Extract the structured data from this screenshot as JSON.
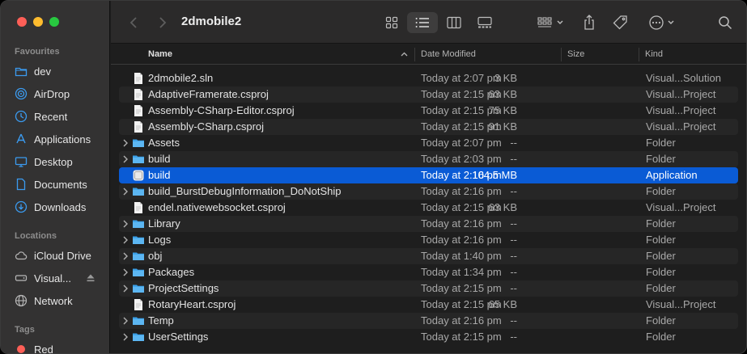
{
  "window": {
    "title": "2dmobile2"
  },
  "sidebar": {
    "sections": [
      {
        "label": "Favourites"
      },
      {
        "label": "Locations"
      },
      {
        "label": "Tags"
      }
    ],
    "favourites": [
      {
        "label": "dev",
        "icon": "folder-icon"
      },
      {
        "label": "AirDrop",
        "icon": "airdrop-icon"
      },
      {
        "label": "Recent",
        "icon": "clock-icon"
      },
      {
        "label": "Applications",
        "icon": "applications-icon"
      },
      {
        "label": "Desktop",
        "icon": "desktop-icon"
      },
      {
        "label": "Documents",
        "icon": "document-icon"
      },
      {
        "label": "Downloads",
        "icon": "download-icon"
      }
    ],
    "locations": [
      {
        "label": "iCloud Drive",
        "icon": "cloud-icon"
      },
      {
        "label": "Visual...",
        "icon": "disk-icon"
      },
      {
        "label": "Network",
        "icon": "network-icon"
      }
    ],
    "tags": [
      {
        "label": "Red",
        "color": "#fe5f57"
      }
    ]
  },
  "columns": {
    "name": "Name",
    "date": "Date Modified",
    "size": "Size",
    "kind": "Kind"
  },
  "files": [
    {
      "name": "2dmobile2.sln",
      "date": "Today at 2:07 pm",
      "size": "3 KB",
      "kind": "Visual...Solution",
      "type": "file"
    },
    {
      "name": "AdaptiveFramerate.csproj",
      "date": "Today at 2:15 pm",
      "size": "63 KB",
      "kind": "Visual...Project",
      "type": "file"
    },
    {
      "name": "Assembly-CSharp-Editor.csproj",
      "date": "Today at 2:15 pm",
      "size": "75 KB",
      "kind": "Visual...Project",
      "type": "file"
    },
    {
      "name": "Assembly-CSharp.csproj",
      "date": "Today at 2:15 pm",
      "size": "91 KB",
      "kind": "Visual...Project",
      "type": "file"
    },
    {
      "name": "Assets",
      "date": "Today at 2:07 pm",
      "size": "--",
      "kind": "Folder",
      "type": "folder"
    },
    {
      "name": "build",
      "date": "Today at 2:03 pm",
      "size": "--",
      "kind": "Folder",
      "type": "folder"
    },
    {
      "name": "build",
      "date": "Today at 2:16 pm",
      "size": "104.5 MB",
      "kind": "Application",
      "type": "app",
      "selected": true
    },
    {
      "name": "build_BurstDebugInformation_DoNotShip",
      "date": "Today at 2:16 pm",
      "size": "--",
      "kind": "Folder",
      "type": "folder"
    },
    {
      "name": "endel.nativewebsocket.csproj",
      "date": "Today at 2:15 pm",
      "size": "63 KB",
      "kind": "Visual...Project",
      "type": "file"
    },
    {
      "name": "Library",
      "date": "Today at 2:16 pm",
      "size": "--",
      "kind": "Folder",
      "type": "folder"
    },
    {
      "name": "Logs",
      "date": "Today at 2:16 pm",
      "size": "--",
      "kind": "Folder",
      "type": "folder"
    },
    {
      "name": "obj",
      "date": "Today at 1:40 pm",
      "size": "--",
      "kind": "Folder",
      "type": "folder"
    },
    {
      "name": "Packages",
      "date": "Today at 1:34 pm",
      "size": "--",
      "kind": "Folder",
      "type": "folder"
    },
    {
      "name": "ProjectSettings",
      "date": "Today at 2:15 pm",
      "size": "--",
      "kind": "Folder",
      "type": "folder"
    },
    {
      "name": "RotaryHeart.csproj",
      "date": "Today at 2:15 pm",
      "size": "65 KB",
      "kind": "Visual...Project",
      "type": "file"
    },
    {
      "name": "Temp",
      "date": "Today at 2:16 pm",
      "size": "--",
      "kind": "Folder",
      "type": "folder"
    },
    {
      "name": "UserSettings",
      "date": "Today at 2:15 pm",
      "size": "--",
      "kind": "Folder",
      "type": "folder"
    }
  ],
  "colors": {
    "accent": "#0a5bd5",
    "folder": "#3aa0e8",
    "sidebarIcon": "#3b9bf0"
  }
}
